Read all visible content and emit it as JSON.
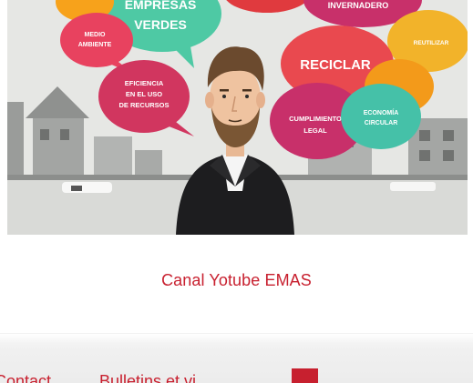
{
  "video": {
    "bubbles": [
      "EMPRESAS",
      "VERDES",
      "MEDIO",
      "AMBIENTE",
      "INVERNADERO",
      "REUTILIZAR",
      "RECICLAR",
      "EFICIENCIA",
      "EN EL USO",
      "DE RECURSOS",
      "CUMPLIMIENTO",
      "LEGAL",
      "ECONOMÍA",
      "CIRCULAR"
    ]
  },
  "caption": {
    "label": "Canal Yotube EMAS"
  },
  "nav": {
    "items": [
      "Contact",
      "Bulletins et vi"
    ]
  },
  "colors": {
    "accent": "#c8202f",
    "green_bubble": "#4ec9a4",
    "orange_bubble": "#f7a21b",
    "pink_bubble": "#e8425f",
    "magenta_bubble": "#c8306a",
    "red_bubble": "#e03a3e"
  }
}
